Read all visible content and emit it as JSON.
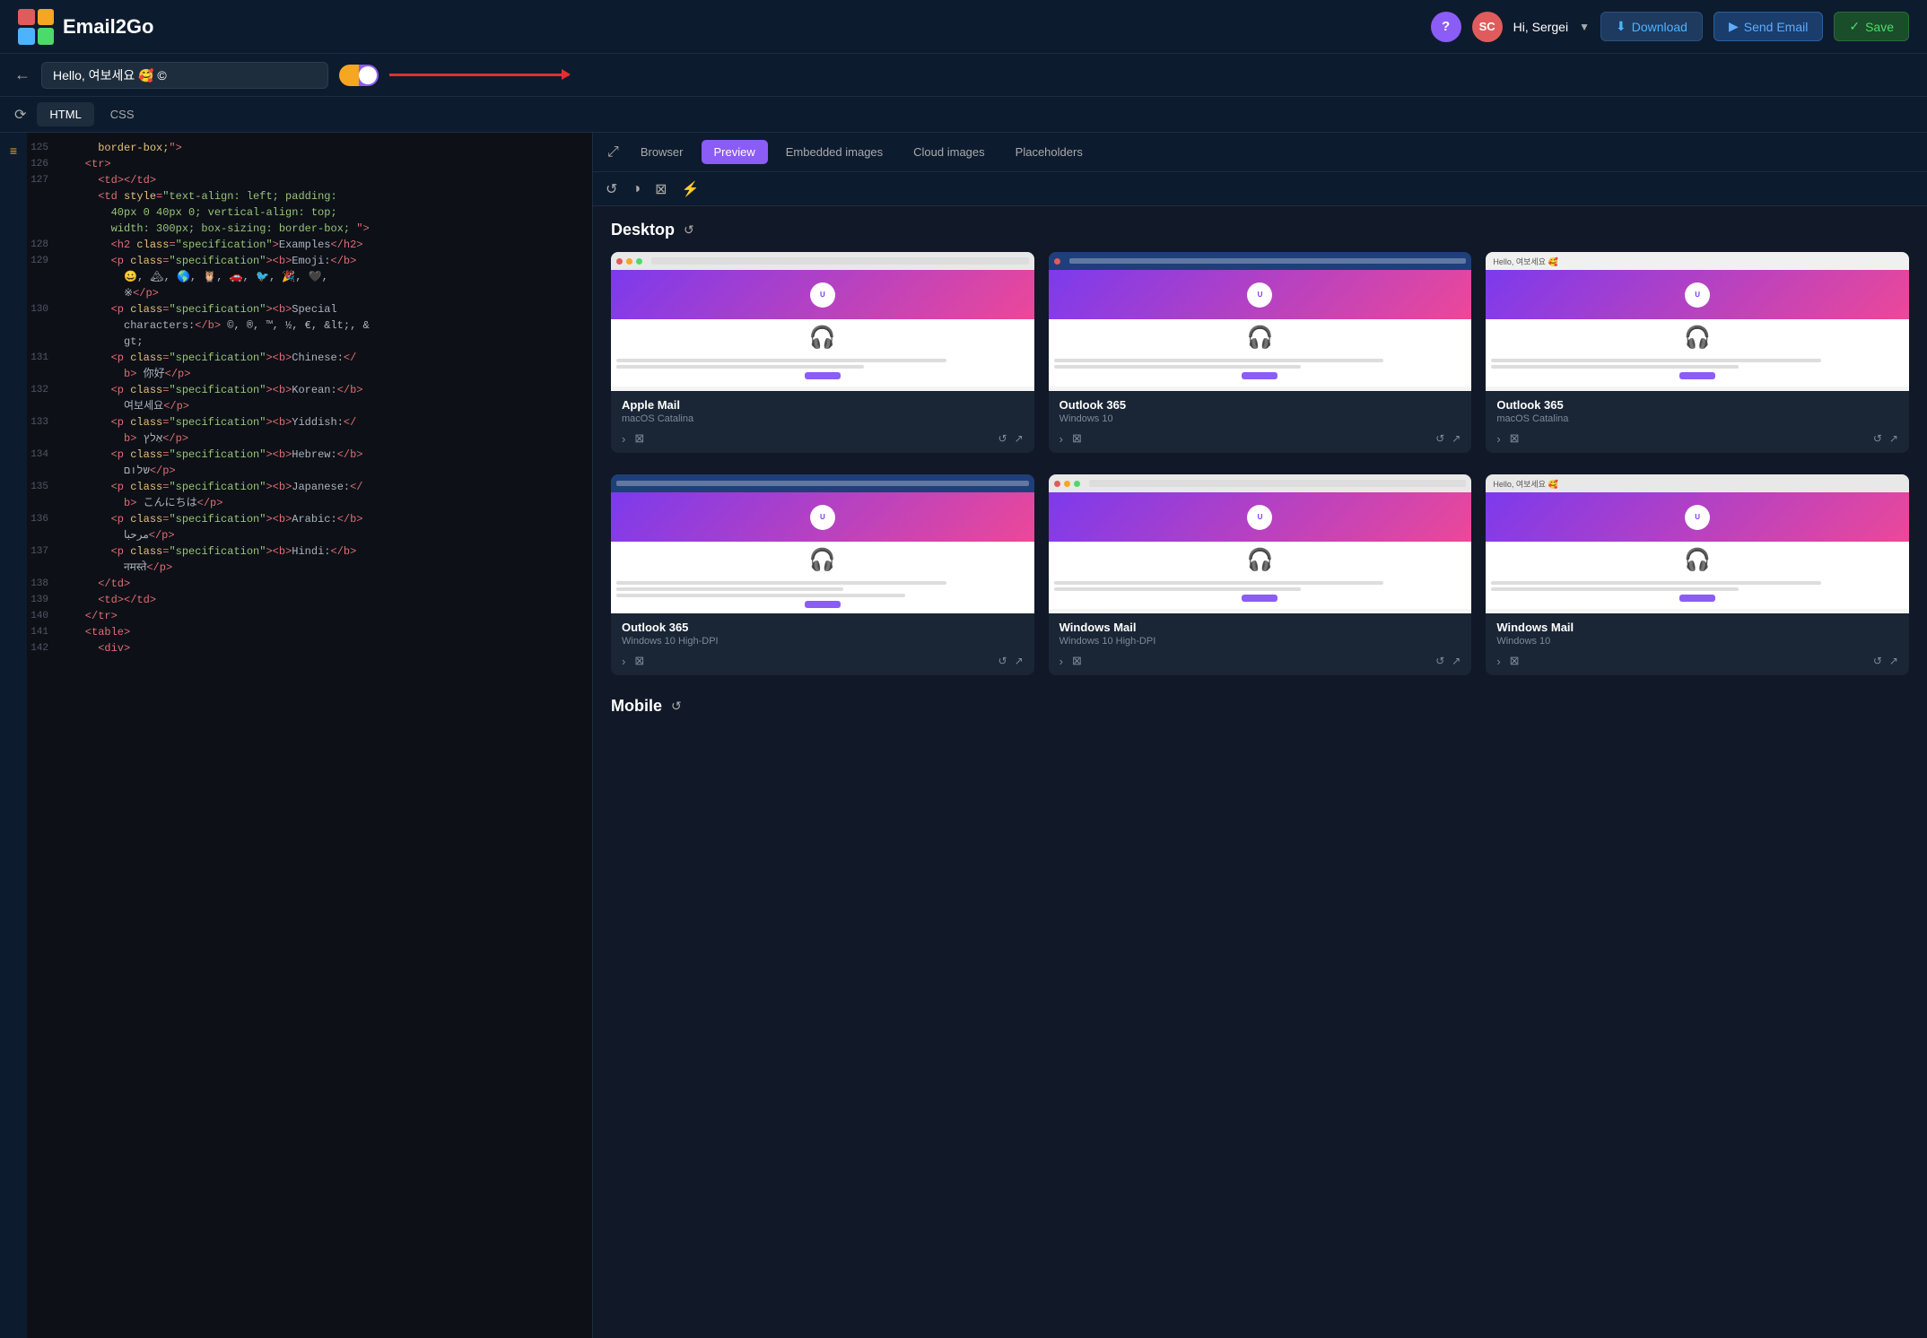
{
  "app": {
    "title": "Email2Go",
    "logo_colors": [
      "#e05c5c",
      "#f5a623",
      "#4db3ff",
      "#4cda6a"
    ]
  },
  "nav": {
    "help_label": "?",
    "avatar_initials": "SC",
    "user_greeting": "Hi, Sergei",
    "download_label": "Download",
    "send_email_label": "Send Email",
    "save_label": "Save"
  },
  "subject_bar": {
    "back_icon": "←",
    "subject_value": "Hello, 여보세요 🥰 ©"
  },
  "editor_tabs": {
    "history_icon": "⟳",
    "tabs": [
      "HTML",
      "CSS"
    ]
  },
  "sidebar": {
    "list_icon": "≡"
  },
  "code_lines": [
    {
      "num": "125",
      "content": "      border-box;\">"
    },
    {
      "num": "126",
      "content": "    <tr>"
    },
    {
      "num": "127",
      "content": "      <td></td>"
    },
    {
      "num": "",
      "content": "      <td style=\"text-align: left; padding:"
    },
    {
      "num": "",
      "content": "        40px 0 40px 0; vertical-align: top;"
    },
    {
      "num": "",
      "content": "        width: 300px; box-sizing: border-box; \">"
    },
    {
      "num": "128",
      "content": "        <h2 class=\"specification\">Examples</h2>"
    },
    {
      "num": "129",
      "content": "        <p class=\"specification\"><b>Emoji:</b>"
    },
    {
      "num": "",
      "content": "          😀, 🏔, 🌎, 🦉, 🚗, 🐦, 🎉, 🖤,"
    },
    {
      "num": "",
      "content": "          ※</p>"
    },
    {
      "num": "130",
      "content": "        <p class=\"specification\"><b>Special"
    },
    {
      "num": "",
      "content": "          characters:</b> ©, ®, ™, ½, €, &lt;, &"
    },
    {
      "num": "",
      "content": "          gt;"
    },
    {
      "num": "131",
      "content": "        <p class=\"specification\"><b>Chinese:</"
    },
    {
      "num": "",
      "content": "          b> 你好</p>"
    },
    {
      "num": "132",
      "content": "        <p class=\"specification\"><b>Korean:</b>"
    },
    {
      "num": "",
      "content": "          여보세요</p>"
    },
    {
      "num": "133",
      "content": "        <p class=\"specification\"><b>Yiddish:</"
    },
    {
      "num": "",
      "content": "          b> אַלץ</p>"
    },
    {
      "num": "134",
      "content": "        <p class=\"specification\"><b>Hebrew:</b>"
    },
    {
      "num": "",
      "content": "          שלום</p>"
    },
    {
      "num": "135",
      "content": "        <p class=\"specification\"><b>Japanese:</"
    },
    {
      "num": "",
      "content": "          b> こんにちは</p>"
    },
    {
      "num": "136",
      "content": "        <p class=\"specification\"><b>Arabic:</b>"
    },
    {
      "num": "",
      "content": "          مرحبا</p>"
    },
    {
      "num": "137",
      "content": "        <p class=\"specification\"><b>Hindi:</b>"
    },
    {
      "num": "",
      "content": "          नमस्ते</p>"
    },
    {
      "num": "138",
      "content": "      </td>"
    },
    {
      "num": "139",
      "content": "      <td></td>"
    },
    {
      "num": "140",
      "content": "    </tr>"
    },
    {
      "num": "141",
      "content": "    <table>"
    },
    {
      "num": "142",
      "content": "      <div>"
    }
  ],
  "preview_panel": {
    "expand_icon": "⤢",
    "tabs": [
      "Browser",
      "Preview",
      "Embedded images",
      "Cloud images",
      "Placeholders"
    ],
    "active_tab": "Preview",
    "sub_icons": [
      "↺",
      "◑",
      "⊠",
      "⚡"
    ],
    "sections": [
      {
        "label": "Desktop",
        "loading": true,
        "cards": [
          {
            "title": "Apple Mail",
            "subtitle": "macOS Catalina",
            "mock_type": "standard"
          },
          {
            "title": "Outlook 365",
            "subtitle": "Windows 10",
            "mock_type": "outlook"
          },
          {
            "title": "Outlook 365",
            "subtitle": "macOS Catalina",
            "mock_type": "outlook_mac"
          }
        ]
      },
      {
        "label": "Mobile",
        "loading": true,
        "cards": [
          {
            "title": "Outlook 365",
            "subtitle": "Windows 10 High-DPI",
            "mock_type": "standard"
          },
          {
            "title": "Windows Mail",
            "subtitle": "Windows 10 High-DPI",
            "mock_type": "standard"
          },
          {
            "title": "Windows Mail",
            "subtitle": "Windows 10",
            "mock_type": "standard"
          }
        ]
      }
    ]
  }
}
